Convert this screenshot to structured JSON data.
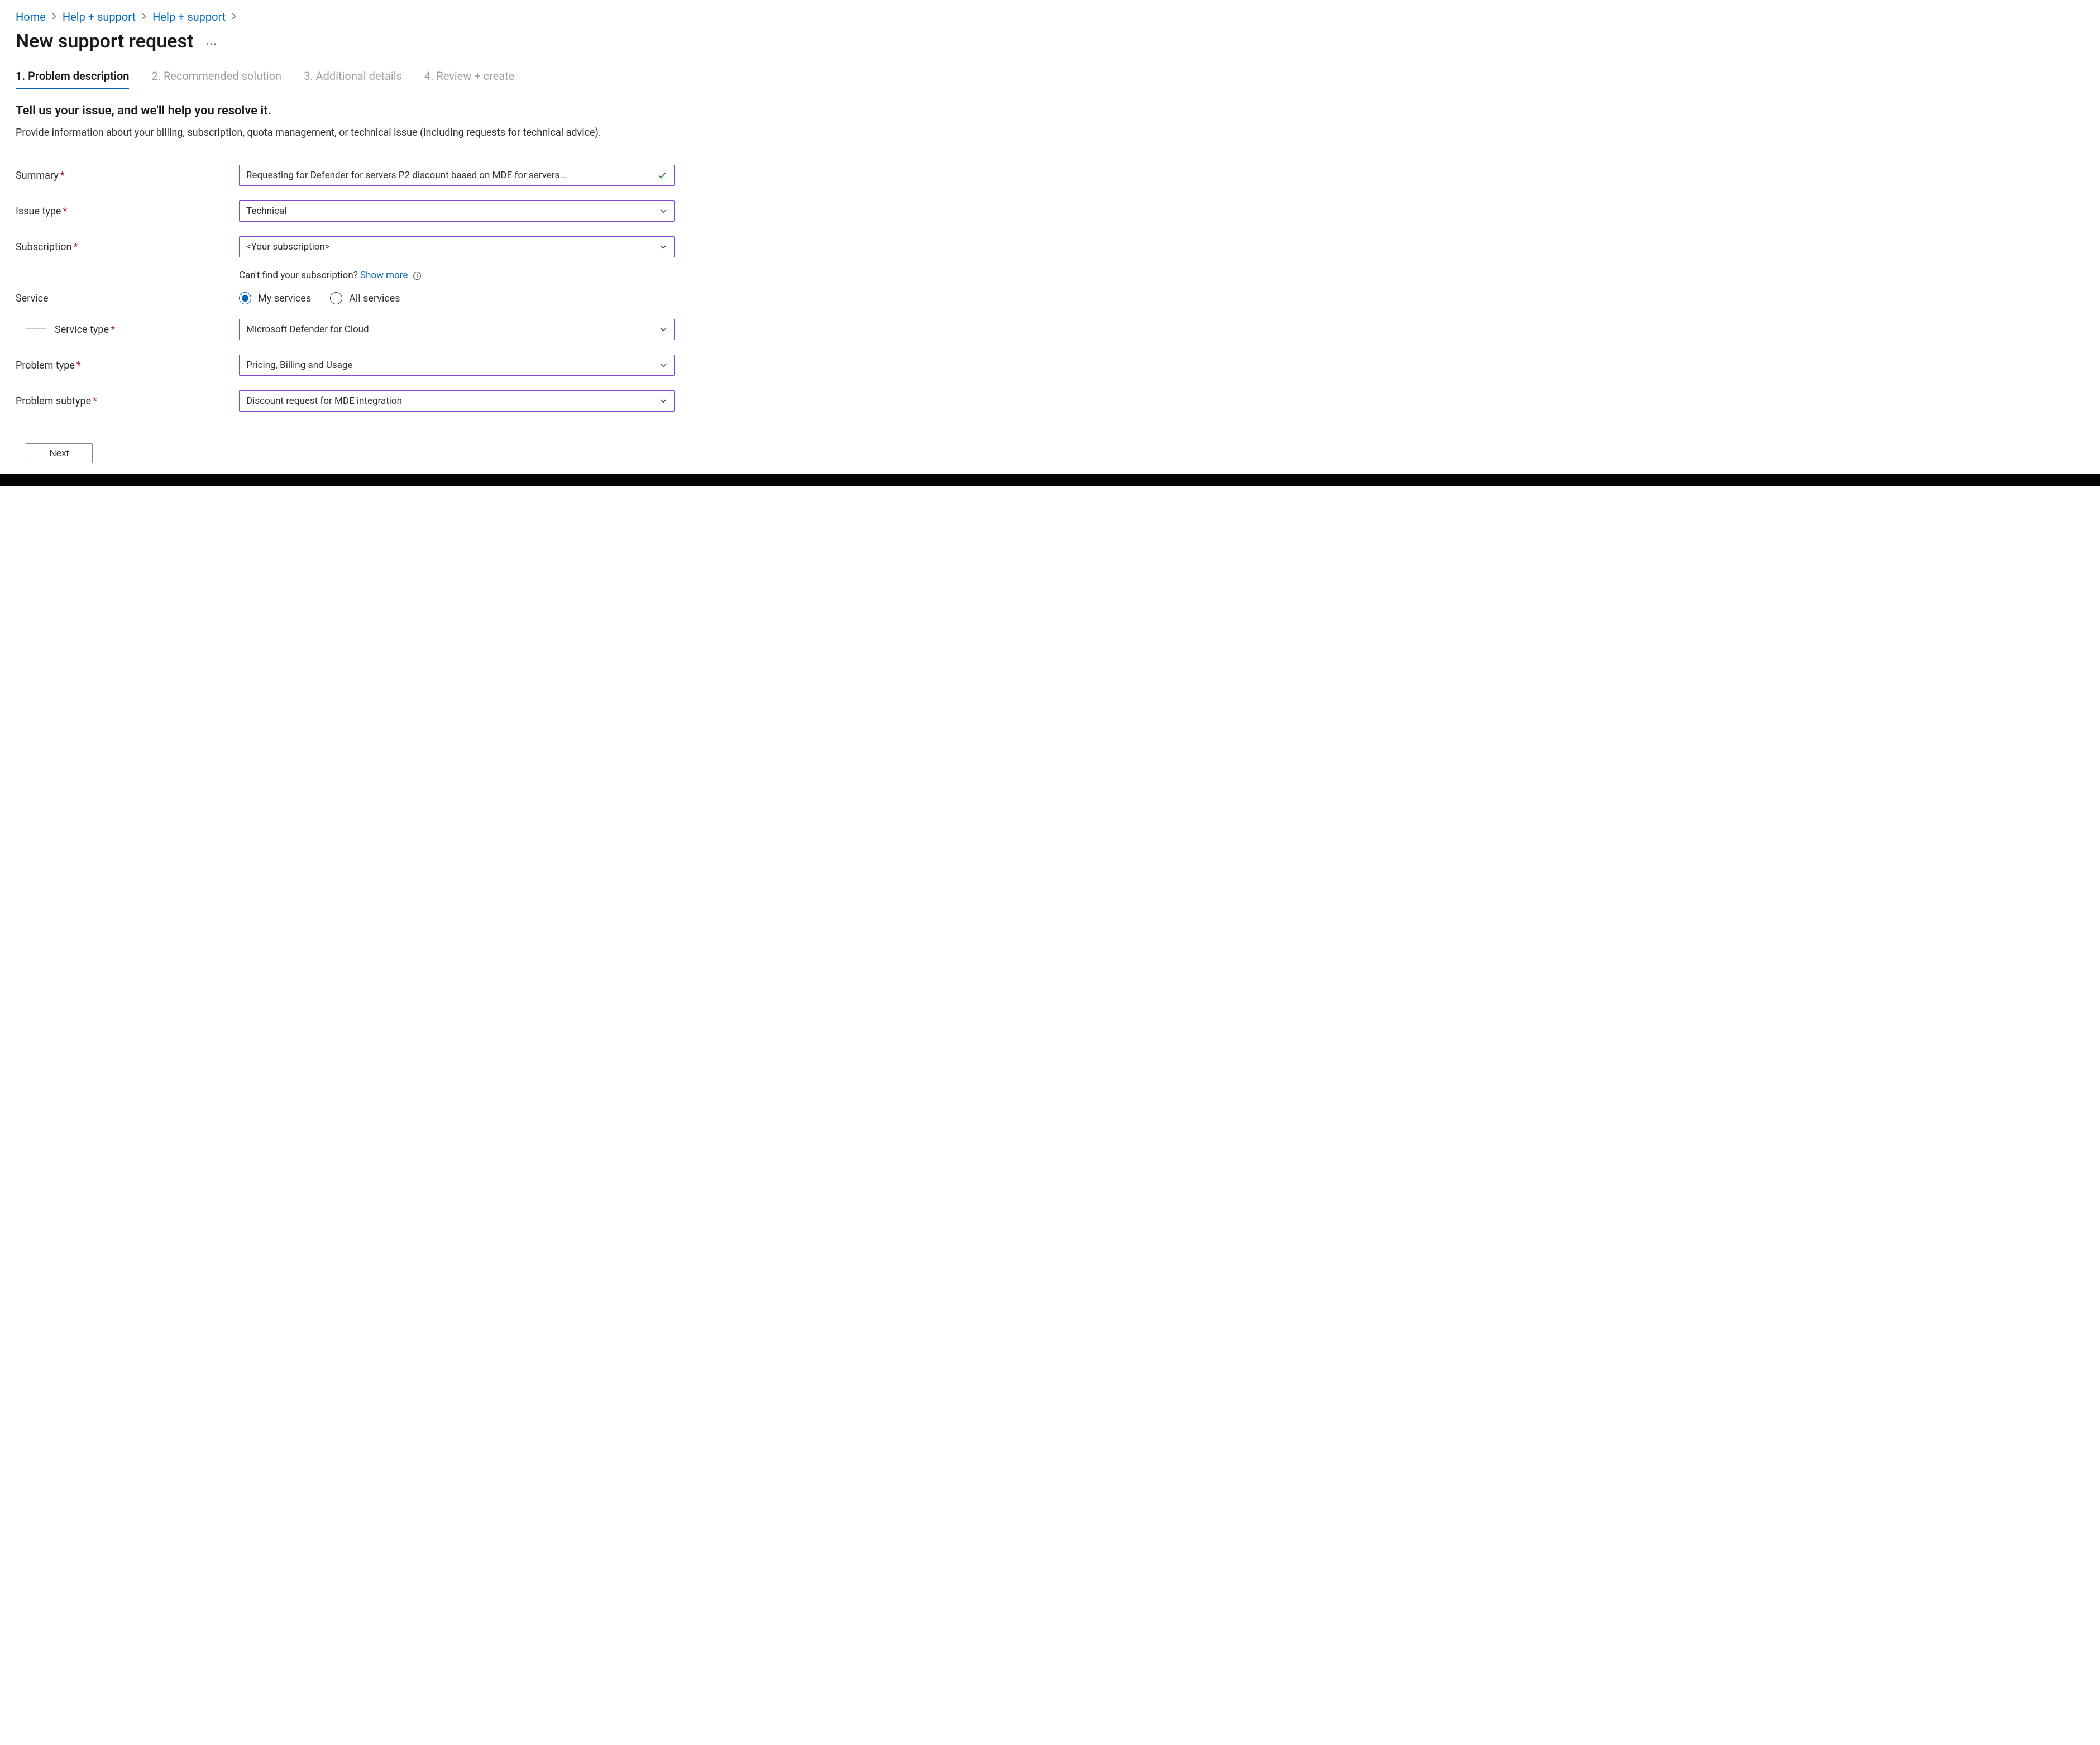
{
  "breadcrumb": {
    "items": [
      "Home",
      "Help + support",
      "Help + support"
    ]
  },
  "page_title": "New support request",
  "tabs": [
    {
      "label": "1. Problem description",
      "active": true
    },
    {
      "label": "2. Recommended solution",
      "active": false
    },
    {
      "label": "3. Additional details",
      "active": false
    },
    {
      "label": "4. Review + create",
      "active": false
    }
  ],
  "subheading": "Tell us your issue, and we'll help you resolve it.",
  "description": "Provide information about your billing, subscription, quota management, or technical issue (including requests for technical advice).",
  "form": {
    "summary": {
      "label": "Summary",
      "value": "Requesting for Defender for servers P2 discount based on MDE for servers..."
    },
    "issue_type": {
      "label": "Issue type",
      "value": "Technical"
    },
    "subscription": {
      "label": "Subscription",
      "value": "<Your subscription>",
      "helper_prefix": "Can't find your subscription? ",
      "helper_link": "Show more"
    },
    "service": {
      "label": "Service",
      "options": {
        "my": "My services",
        "all": "All services"
      },
      "selected": "my"
    },
    "service_type": {
      "label": "Service type",
      "value": "Microsoft Defender for Cloud"
    },
    "problem_type": {
      "label": "Problem type",
      "value": "Pricing, Billing and Usage"
    },
    "problem_subtype": {
      "label": "Problem subtype",
      "value": "Discount request for MDE integration"
    }
  },
  "footer": {
    "next": "Next"
  }
}
